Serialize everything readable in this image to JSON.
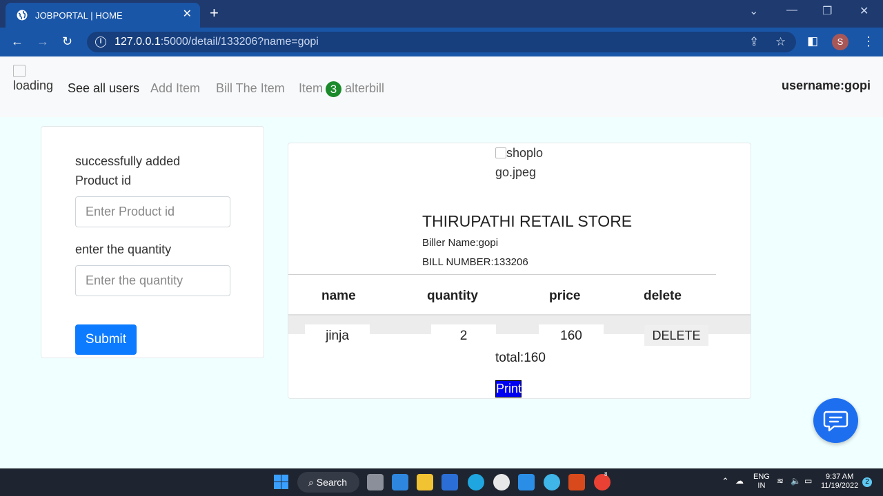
{
  "browser": {
    "tab_title": "JOBPORTAL | HOME",
    "url_host": "127.0.0.1",
    "url_rest": ":5000/detail/133206?name=gopi",
    "profile_initial": "S"
  },
  "navbar": {
    "logo_alt": "loading",
    "links": [
      "See all users",
      "Add Item",
      "Bill The Item",
      "Item",
      "alterbill"
    ],
    "cart_count": "3",
    "username": "username:gopi"
  },
  "form": {
    "success_message": "successfully added",
    "product_label": "Product id",
    "product_placeholder": "Enter Product id",
    "quantity_label": "enter the quantity",
    "quantity_placeholder": "Enter the quantity",
    "submit_label": "Submit"
  },
  "bill": {
    "logo_alt": "shoplogo.jpeg",
    "store_name": "THIRUPATHI RETAIL STORE",
    "biller": "Biller Name:gopi",
    "bill_number": "BILL NUMBER:133206",
    "columns": [
      "name",
      "quantity",
      "price",
      "delete"
    ],
    "rows": [
      {
        "name": "jinja",
        "quantity": "2",
        "price": "160",
        "delete_label": "DELETE"
      }
    ],
    "total": "total:160",
    "print_label": "Print"
  },
  "taskbar": {
    "search_label": "Search",
    "lang_top": "ENG",
    "lang_bottom": "IN",
    "time": "9:37 AM",
    "date": "11/19/2022",
    "notification_count": "2",
    "chrome_badge": "8"
  },
  "colors": {
    "accent": "#0d7bff",
    "page_bg": "#f0ffff",
    "badge": "#1a8a2a",
    "print": "#0000f0"
  }
}
